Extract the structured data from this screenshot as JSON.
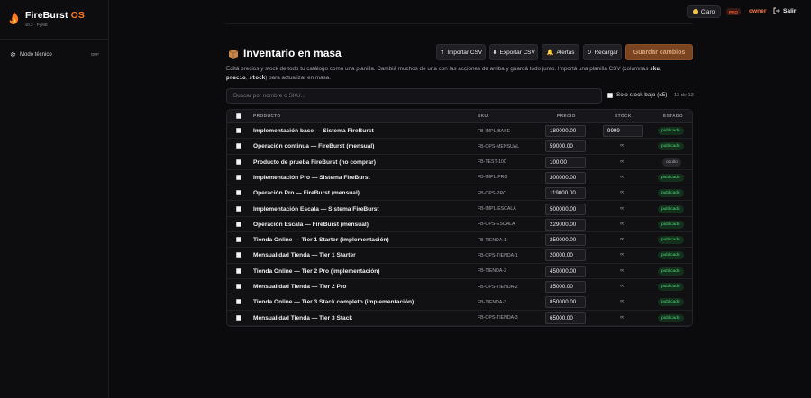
{
  "brand": {
    "name_main": "FireBurst",
    "name_accent": "OS",
    "subtitle": "v0.2 · PyME"
  },
  "sidebar": {
    "items": [
      {
        "label": "Modo técnico",
        "state": "OFF"
      }
    ]
  },
  "topbar": {
    "theme_label": "Claro",
    "plan_badge": "PRO",
    "role": "owner",
    "logout_label": "Salir"
  },
  "header": {
    "title": "Inventario en masa",
    "description_parts": [
      "Editá precios y stock de todo tu catálogo como una planilla. Cambiá muchos de una con las acciones de arriba y guardá todo junto. Importá una planilla CSV (columnas ",
      "sku",
      ", ",
      "precio",
      ", ",
      "stock",
      ") para actualizar en masa."
    ]
  },
  "actions": {
    "import": "Importar CSV",
    "export": "Exportar CSV",
    "alerts": "Alertas",
    "reload": "Recargar",
    "save": "Guardar cambios"
  },
  "search": {
    "placeholder": "Buscar por nombre o SKU..."
  },
  "filters": {
    "low_stock_label": "Solo stock bajo (≤5)",
    "count": "13 de 13"
  },
  "table": {
    "headers": {
      "product": "PRODUCTO",
      "sku": "SKU",
      "price": "PRECIO",
      "stock": "STOCK",
      "status": "ESTADO"
    },
    "rows": [
      {
        "name": "Implementación base — Sistema FireBurst",
        "sku": "FB-IMPL-BASE",
        "price": "180000.00",
        "stock": "9999",
        "status": "publicado"
      },
      {
        "name": "Operación continua — FireBurst (mensual)",
        "sku": "FB-OPS-MENSUAL",
        "price": "59000.00",
        "stock": "∞",
        "status": "publicado"
      },
      {
        "name": "Producto de prueba FireBurst (no comprar)",
        "sku": "FB-TEST-100",
        "price": "100.00",
        "stock": "∞",
        "status": "oculto"
      },
      {
        "name": "Implementación Pro — Sistema FireBurst",
        "sku": "FB-IMPL-PRO",
        "price": "300000.00",
        "stock": "∞",
        "status": "publicado"
      },
      {
        "name": "Operación Pro — FireBurst (mensual)",
        "sku": "FB-OPS-PRO",
        "price": "119000.00",
        "stock": "∞",
        "status": "publicado"
      },
      {
        "name": "Implementación Escala — Sistema FireBurst",
        "sku": "FB-IMPL-ESCALA",
        "price": "500000.00",
        "stock": "∞",
        "status": "publicado"
      },
      {
        "name": "Operación Escala — FireBurst (mensual)",
        "sku": "FB-OPS-ESCALA",
        "price": "229000.00",
        "stock": "∞",
        "status": "publicado"
      },
      {
        "name": "Tienda Online — Tier 1 Starter (implementación)",
        "sku": "FB-TIENDA-1",
        "price": "250000.00",
        "stock": "∞",
        "status": "publicado"
      },
      {
        "name": "Mensualidad Tienda — Tier 1 Starter",
        "sku": "FB-OPS-TIENDA-1",
        "price": "20000.00",
        "stock": "∞",
        "status": "publicado"
      },
      {
        "name": "Tienda Online — Tier 2 Pro (implementación)",
        "sku": "FB-TIENDA-2",
        "price": "450000.00",
        "stock": "∞",
        "status": "publicado"
      },
      {
        "name": "Mensualidad Tienda — Tier 2 Pro",
        "sku": "FB-OPS-TIENDA-2",
        "price": "35000.00",
        "stock": "∞",
        "status": "publicado"
      },
      {
        "name": "Tienda Online — Tier 3 Stack completo (implementación)",
        "sku": "FB-TIENDA-3",
        "price": "850000.00",
        "stock": "∞",
        "status": "publicado"
      },
      {
        "name": "Mensualidad Tienda — Tier 3 Stack",
        "sku": "FB-OPS-TIENDA-3",
        "price": "65000.00",
        "stock": "∞",
        "status": "publicado"
      }
    ]
  },
  "colors": {
    "accent": "#ff7a1a",
    "background": "#0b0b0e",
    "published": "#56d27a",
    "save_button": "#7a4420"
  }
}
